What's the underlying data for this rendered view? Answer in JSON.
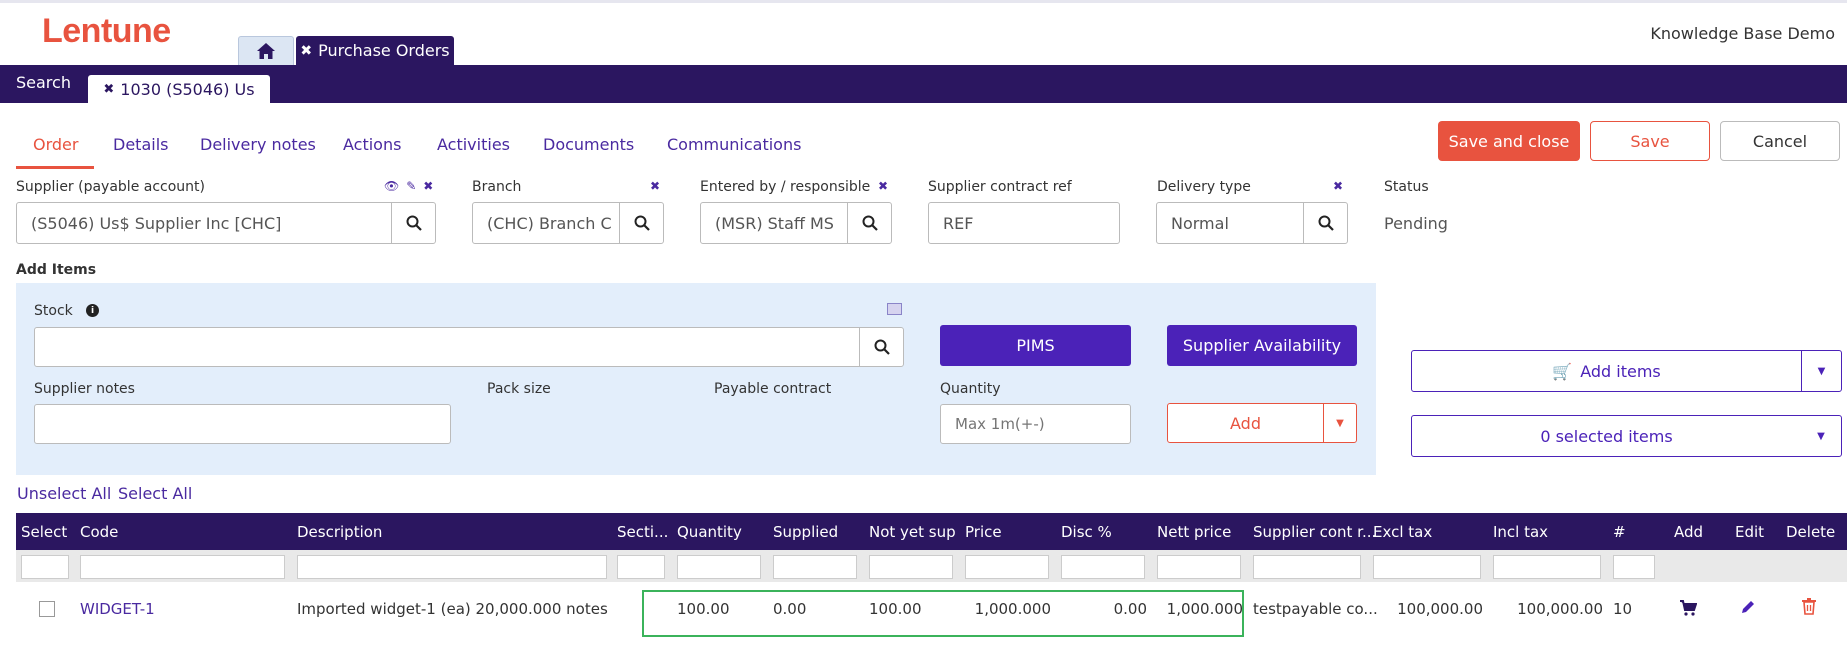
{
  "app": {
    "logo": "Lentune",
    "account": "Knowledge Base Demo"
  },
  "tabs": {
    "home_icon": "home-icon",
    "purchase_orders": "Purchase Orders",
    "search": "Search",
    "order_tab": "1030 (S5046) Us"
  },
  "subtabs": [
    "Order",
    "Details",
    "Delivery notes",
    "Actions",
    "Activities",
    "Documents",
    "Communications"
  ],
  "actions": {
    "save_close": "Save and close",
    "save": "Save",
    "cancel": "Cancel"
  },
  "fields": {
    "supplier_label": "Supplier (payable account)",
    "supplier_value": "(S5046) Us$ Supplier Inc [CHC]",
    "branch_label": "Branch",
    "branch_value": "(CHC) Branch C",
    "entered_label": "Entered by / responsible",
    "entered_value": "(MSR) Staff MS",
    "contract_label": "Supplier contract ref",
    "contract_value": "REF",
    "delivery_label": "Delivery type",
    "delivery_value": "Normal",
    "status_label": "Status",
    "status_value": "Pending"
  },
  "add_items": {
    "title": "Add Items",
    "stock_label": "Stock",
    "supplier_notes_label": "Supplier notes",
    "pack_size_label": "Pack size",
    "payable_contract_label": "Payable contract",
    "quantity_label": "Quantity",
    "quantity_placeholder": "Max 1m(+-)",
    "pims": "PIMS",
    "supplier_availability": "Supplier Availability",
    "add": "Add",
    "add_items_btn": "Add items",
    "selected_items": "0 selected items"
  },
  "selection": {
    "unselect_all": "Unselect All",
    "select_all": "Select All"
  },
  "table": {
    "headers": [
      "Select",
      "Code",
      "Description",
      "Secti...",
      "Quantity",
      "Supplied",
      "Not yet sup",
      "Price",
      "Disc %",
      "Nett price",
      "Supplier cont r...",
      "Excl tax",
      "Incl tax",
      "#",
      "Add",
      "Edit",
      "Delete"
    ],
    "row": {
      "code": "WIDGET-1",
      "description": "Imported widget-1 (ea) 20,000.000 notes",
      "quantity": "100.00",
      "supplied": "0.00",
      "not_yet_sup": "100.00",
      "price": "1,000.000",
      "disc": "0.00",
      "nett_price": "1,000.000",
      "supplier_cont_ref": "testpayable co...",
      "excl_tax": "100,000.00",
      "incl_tax": "100,000.00",
      "count": "10"
    }
  },
  "colors": {
    "brand": "#e8533f",
    "nav": "#2b1660",
    "accent": "#4b22b8",
    "highlight": "#3bb35b"
  }
}
